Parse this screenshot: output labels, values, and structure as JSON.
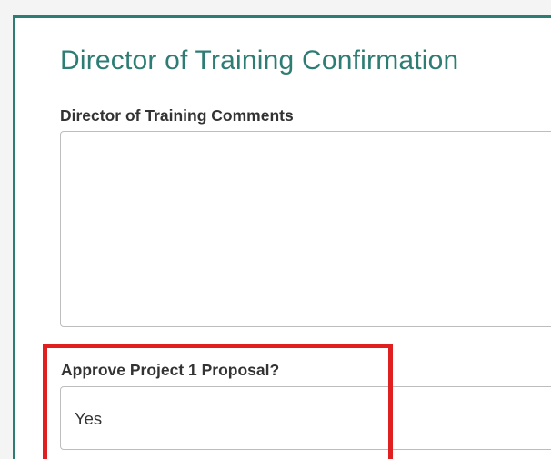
{
  "form": {
    "title": "Director of Training Confirmation",
    "comments": {
      "label": "Director of Training Comments",
      "value": ""
    },
    "approve": {
      "label": "Approve Project 1 Proposal?",
      "value": "Yes"
    }
  },
  "colors": {
    "accent": "#2e7d74",
    "highlight": "#e02020",
    "label_text": "#333333",
    "field_border": "#bdbdbd"
  }
}
